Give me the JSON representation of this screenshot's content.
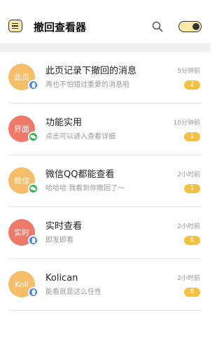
{
  "header": {
    "title": "撤回查看器",
    "menu_icon": "menu-icon",
    "search_icon": "search-icon",
    "toggle_icon": "toggle-switch-icon",
    "accent_color": "#fce9a8"
  },
  "list": {
    "items": [
      {
        "avatar_text": "此页",
        "avatar_color": "#f7be6a",
        "app": "qq",
        "title": "此页记录下撤回的消息",
        "subtitle": "再也不怕错过重要的消息啦",
        "time": "5分钟前",
        "count": "2"
      },
      {
        "avatar_text": "界面",
        "avatar_color": "#f07a6a",
        "app": "wechat",
        "title": "功能实用",
        "subtitle": "点击可以进入查看详细",
        "time": "10分钟前",
        "count": "1"
      },
      {
        "avatar_text": "微信",
        "avatar_color": "#f7be6a",
        "app": "wechat",
        "title": "微信QQ都能查看",
        "subtitle": "哈哈哈 我看到你撤回了～",
        "time": "2小时前",
        "count": "1"
      },
      {
        "avatar_text": "实时",
        "avatar_color": "#f07a6a",
        "app": "qq",
        "title": "实时查看",
        "subtitle": "即发即看",
        "time": "2小时前",
        "count": "6"
      },
      {
        "avatar_text": "Koli",
        "avatar_color": "#f7be6a",
        "app": "qq",
        "title": "Kolican",
        "subtitle": "能看就是这么任性",
        "time": "2小时前",
        "count": "8"
      }
    ],
    "badge_color": "#f4c13d",
    "qq_color": "#3f84e5",
    "wechat_color": "#2eb34a"
  }
}
